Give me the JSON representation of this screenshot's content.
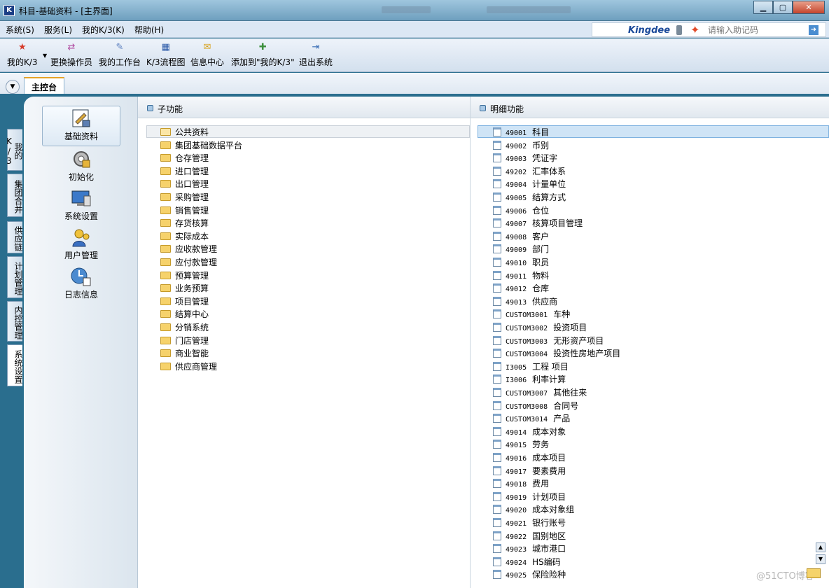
{
  "window": {
    "title": "科目-基础资料 - [主界面]",
    "controls": [
      "minimize",
      "maximize",
      "close"
    ]
  },
  "menubar": {
    "items": [
      "系统(S)",
      "服务(L)",
      "我的K/3(K)",
      "帮助(H)"
    ],
    "brand": "Kingdee",
    "help_placeholder": "请输入助记码"
  },
  "toolbar": {
    "items": [
      {
        "label": "我的K/3",
        "icon": "star-icon"
      },
      {
        "label": "更换操作员",
        "icon": "switch-user-icon"
      },
      {
        "label": "我的工作台",
        "icon": "workbench-icon"
      },
      {
        "label": "K/3流程图",
        "icon": "flowchart-icon"
      },
      {
        "label": "信息中心",
        "icon": "message-icon"
      },
      {
        "label": "添加到\"我的K/3\"",
        "icon": "add-favorite-icon"
      },
      {
        "label": "退出系统",
        "icon": "exit-icon"
      }
    ]
  },
  "tabs": {
    "main": "主控台"
  },
  "side_tabs": [
    "我的K/3",
    "集团合并",
    "供应链",
    "计划管理",
    "内控管理",
    "系统设置"
  ],
  "nav": {
    "items": [
      {
        "label": "基础资料",
        "icon": "basic-data-icon",
        "active": true
      },
      {
        "label": "初始化",
        "icon": "initialize-icon",
        "active": false
      },
      {
        "label": "系统设置",
        "icon": "system-settings-icon",
        "active": false
      },
      {
        "label": "用户管理",
        "icon": "user-management-icon",
        "active": false
      },
      {
        "label": "日志信息",
        "icon": "log-info-icon",
        "active": false
      }
    ]
  },
  "subfunctions": {
    "header": "子功能",
    "items": [
      "公共资料",
      "集团基础数据平台",
      "仓存管理",
      "进口管理",
      "出口管理",
      "采购管理",
      "销售管理",
      "存货核算",
      "实际成本",
      "应收款管理",
      "应付款管理",
      "预算管理",
      "业务预算",
      "项目管理",
      "结算中心",
      "分销系统",
      "门店管理",
      "商业智能",
      "供应商管理"
    ]
  },
  "details": {
    "header": "明细功能",
    "items": [
      {
        "code": "49001",
        "name": "科目"
      },
      {
        "code": "49002",
        "name": "币别"
      },
      {
        "code": "49003",
        "name": "凭证字"
      },
      {
        "code": "49202",
        "name": "汇率体系"
      },
      {
        "code": "49004",
        "name": "计量单位"
      },
      {
        "code": "49005",
        "name": "结算方式"
      },
      {
        "code": "49006",
        "name": "仓位"
      },
      {
        "code": "49007",
        "name": "核算项目管理"
      },
      {
        "code": "49008",
        "name": "客户"
      },
      {
        "code": "49009",
        "name": "部门"
      },
      {
        "code": "49010",
        "name": "职员"
      },
      {
        "code": "49011",
        "name": "物料"
      },
      {
        "code": "49012",
        "name": "仓库"
      },
      {
        "code": "49013",
        "name": "供应商"
      },
      {
        "code": "CUSTOM3001",
        "name": "车种"
      },
      {
        "code": "CUSTOM3002",
        "name": "投资项目"
      },
      {
        "code": "CUSTOM3003",
        "name": "无形资产项目"
      },
      {
        "code": "CUSTOM3004",
        "name": "投资性房地产项目"
      },
      {
        "code": "I3005",
        "name": "工程 项目"
      },
      {
        "code": "I3006",
        "name": "利率计算"
      },
      {
        "code": "CUSTOM3007",
        "name": "其他往来"
      },
      {
        "code": "CUSTOM3008",
        "name": "合同号"
      },
      {
        "code": "CUSTOM3014",
        "name": "产品"
      },
      {
        "code": "49014",
        "name": "成本对象"
      },
      {
        "code": "49015",
        "name": "劳务"
      },
      {
        "code": "49016",
        "name": "成本项目"
      },
      {
        "code": "49017",
        "name": "要素费用"
      },
      {
        "code": "49018",
        "name": "费用"
      },
      {
        "code": "49019",
        "name": "计划项目"
      },
      {
        "code": "49020",
        "name": "成本对象组"
      },
      {
        "code": "49021",
        "name": "银行账号"
      },
      {
        "code": "49022",
        "name": "国别地区"
      },
      {
        "code": "49023",
        "name": "城市港口"
      },
      {
        "code": "49024",
        "name": "HS编码"
      },
      {
        "code": "49025",
        "name": "保险险种"
      }
    ]
  },
  "watermark": "@51CTO博客"
}
